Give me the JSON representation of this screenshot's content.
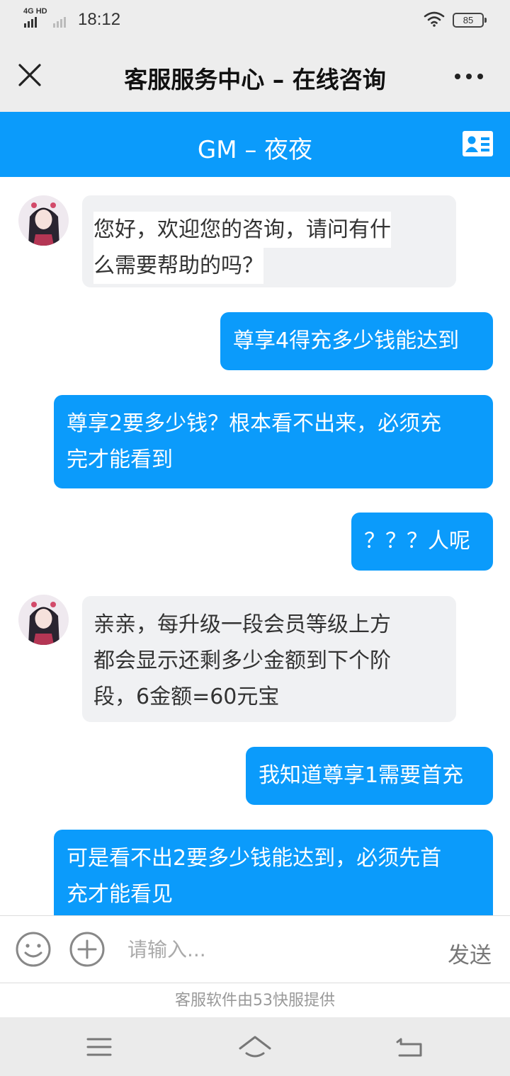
{
  "status_bar": {
    "network": "4G HD",
    "time": "18:12",
    "battery": "85",
    "icons": [
      "signal-icon",
      "wifi-icon",
      "battery-icon"
    ]
  },
  "title_bar": {
    "title": "客服服务中心 – 在线咨询",
    "close_icon": "close-icon",
    "more_icon": "more-icon"
  },
  "agent_bar": {
    "name": "GM – 夜夜",
    "contact_card_icon": "contact-card-icon",
    "color": "#0b9bfb"
  },
  "messages": [
    {
      "from": "agent",
      "lines": [
        "您好，欢迎您的咨询，请问有什",
        "么需要帮助的吗？"
      ]
    },
    {
      "from": "user",
      "lines": [
        "尊享4得充多少钱能达到"
      ]
    },
    {
      "from": "user",
      "lines": [
        "尊享2要多少钱？根本看不出来，必须充",
        "完才能看到"
      ]
    },
    {
      "from": "user",
      "lines": [
        "？？？人呢"
      ]
    },
    {
      "from": "agent",
      "lines": [
        "亲亲，每升级一段会员等级上方",
        "都会显示还剩多少金额到下个阶",
        "段，6金额=60元宝"
      ]
    },
    {
      "from": "user",
      "lines": [
        "我知道尊享1需要首充"
      ]
    },
    {
      "from": "user",
      "lines": [
        "可是看不出2要多少钱能达到，必须先首",
        "充才能看见"
      ]
    }
  ],
  "input_bar": {
    "placeholder": "请输入...",
    "send_label": "发送",
    "icons": [
      "emoji-icon",
      "plus-icon"
    ]
  },
  "footer": {
    "powered_by": "客服软件由53快服提供"
  },
  "nav_bar": {
    "icons": [
      "menu-icon",
      "home-icon",
      "back-icon"
    ]
  }
}
